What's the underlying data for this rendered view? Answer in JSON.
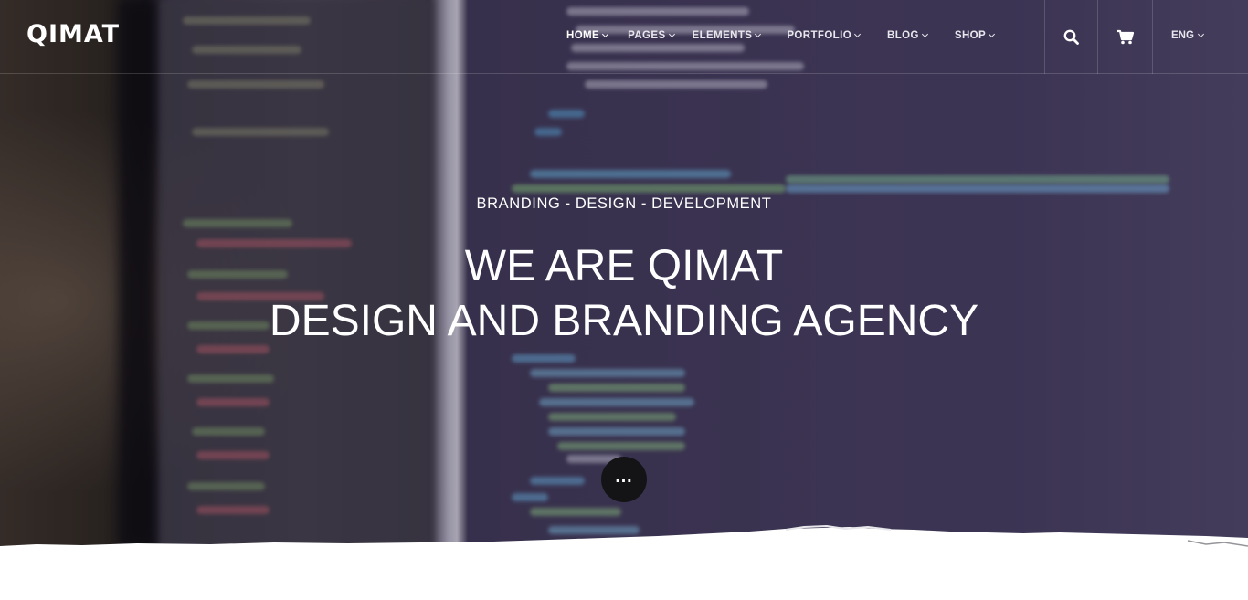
{
  "brand": {
    "logo_text": "QIMAT"
  },
  "nav": {
    "items": [
      {
        "label": "HOME",
        "active": true
      },
      {
        "label": "PAGES",
        "active": false
      },
      {
        "label": "ELEMENTS",
        "active": false
      },
      {
        "label": "PORTFOLIO",
        "active": false
      },
      {
        "label": "BLOG",
        "active": false
      },
      {
        "label": "SHOP",
        "active": false
      }
    ],
    "search_icon": "search-icon",
    "cart_icon": "cart-icon",
    "language": "ENG"
  },
  "hero": {
    "subtitle": "BRANDING - DESIGN - DEVELOPMENT",
    "headline_line1": "WE ARE QIMAT",
    "headline_line2": "DESIGN AND BRANDING AGENCY",
    "more_icon": "more-dots-icon"
  },
  "colors": {
    "text": "#ffffff",
    "hero_bg": "#3f3756",
    "more_button": "#141416"
  }
}
